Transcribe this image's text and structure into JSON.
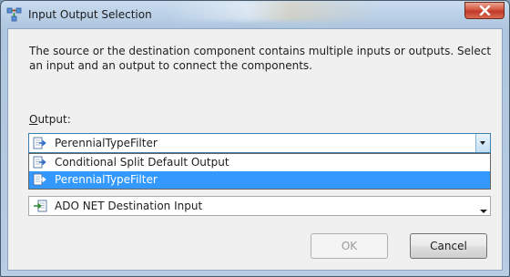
{
  "window": {
    "title": "Input Output Selection",
    "close_icon": "close-icon",
    "app_icon": "ssis-path-icon"
  },
  "dialog": {
    "description": "The source or the destination component contains multiple inputs or outputs. Select an input and an output to connect the components.",
    "output_label_accelerator": "O",
    "output_label_rest": "utput:"
  },
  "output_combo": {
    "selected": "PerennialTypeFilter",
    "icon": "output-arrow-icon"
  },
  "output_dropdown": {
    "options": [
      {
        "label": "Conditional Split Default Output",
        "icon": "output-arrow-icon",
        "selected": false
      },
      {
        "label": "PerennialTypeFilter",
        "icon": "output-arrow-icon",
        "selected": true
      }
    ]
  },
  "input_combo": {
    "selected": "ADO NET Destination Input",
    "icon": "input-arrow-icon"
  },
  "buttons": {
    "ok_label": "OK",
    "ok_enabled": false,
    "cancel_label": "Cancel"
  },
  "colors": {
    "selection": "#3399ff",
    "close_button": "#c0392b",
    "dialog_background": "#f0f0f0"
  }
}
